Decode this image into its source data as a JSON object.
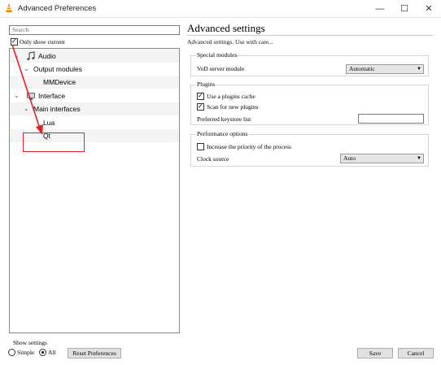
{
  "window": {
    "title": "Advanced Preferences",
    "minimize": "—",
    "maximize": "☐",
    "close": "✕"
  },
  "left": {
    "search_placeholder": "Search",
    "only_show_current": "Only show current",
    "tree": [
      {
        "label": "Audio"
      },
      {
        "label": "Output modules"
      },
      {
        "label": "MMDevice"
      },
      {
        "label": "Interface"
      },
      {
        "label": "Main interfaces"
      },
      {
        "label": "Lua"
      },
      {
        "label": "Qt"
      }
    ]
  },
  "show_settings": {
    "label": "Show settings",
    "simple": "Simple",
    "all": "All",
    "selected": "All"
  },
  "buttons": {
    "reset": "Reset Preferences",
    "save": "Save",
    "cancel": "Cancel"
  },
  "right": {
    "title": "Advanced settings",
    "subtitle": "Advanced settings. Use with care...",
    "special_modules": {
      "title": "Special modules",
      "vod_label": "VoD server module",
      "vod_value": "Automatic"
    },
    "plugins": {
      "title": "Plugins",
      "use_cache": "Use a plugins cache",
      "use_cache_checked": true,
      "scan_new": "Scan for new plugins",
      "scan_new_checked": true,
      "keystore_label": "Preferred keystore list",
      "keystore_value": ""
    },
    "performance": {
      "title": "Performance options",
      "increase_priority": "Increase the priority of the process",
      "increase_priority_checked": false,
      "clock_label": "Clock source",
      "clock_value": "Auto"
    }
  },
  "colors": {
    "annotation_red": "#e0212a",
    "vlc_orange": "#f08a00"
  }
}
